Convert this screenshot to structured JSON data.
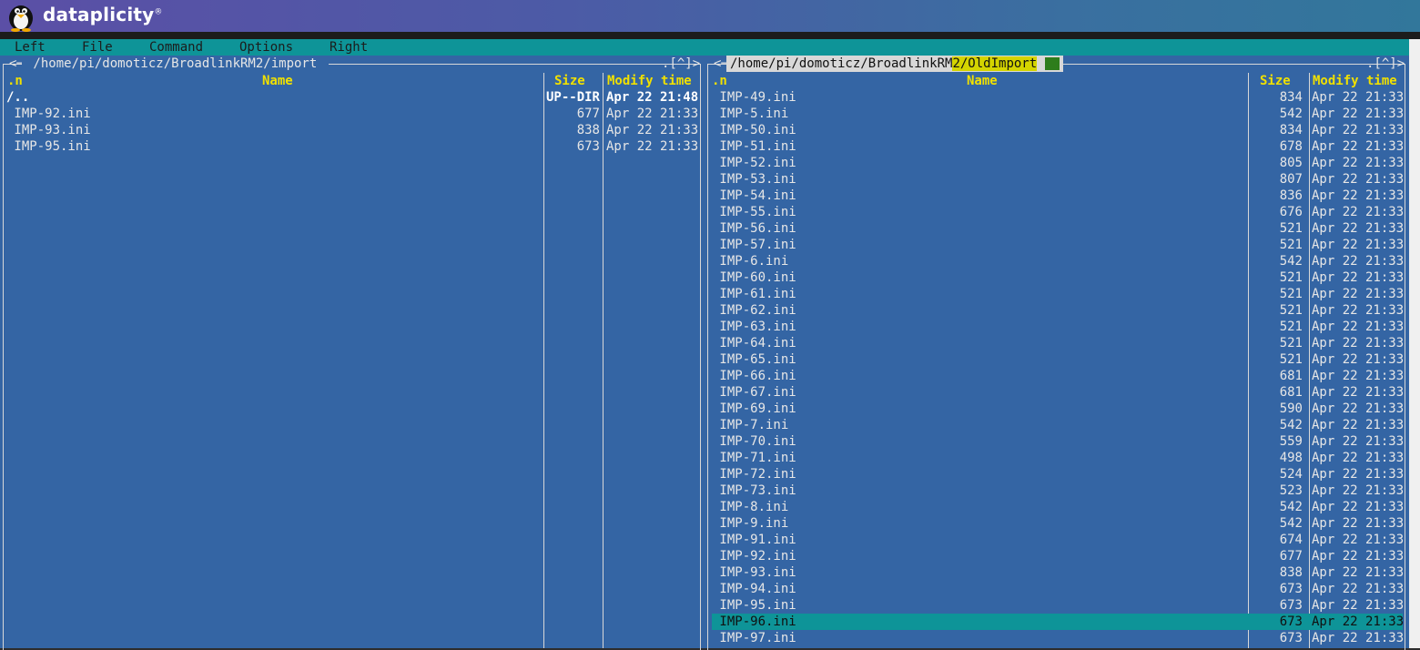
{
  "brand": {
    "name": "dataplicity",
    "reg": "®"
  },
  "menu": [
    "Left",
    "File",
    "Command",
    "Options",
    "Right"
  ],
  "left_panel": {
    "nav": "<─",
    "path": " /home/pi/domoticz/BroadlinkRM2/import ",
    "corner": ".[^]>",
    "headers": {
      "sort": ".n",
      "name": "Name",
      "size": "Size",
      "time": "Modify time"
    },
    "rows": [
      {
        "name": "/..",
        "size": "UP--DIR",
        "time": "Apr 22 21:48",
        "updir": true
      },
      {
        "name": " IMP-92.ini",
        "size": "677",
        "time": "Apr 22 21:33"
      },
      {
        "name": " IMP-93.ini",
        "size": "838",
        "time": "Apr 22 21:33"
      },
      {
        "name": " IMP-95.ini",
        "size": "673",
        "time": "Apr 22 21:33"
      }
    ]
  },
  "right_panel": {
    "nav": "<─",
    "path_a": "/home/pi/domoticz/BroadlinkRM",
    "path_b": "2/OldImport",
    "corner": ".[^]>",
    "headers": {
      "sort": ".n",
      "name": "Name",
      "size": "Size",
      "time": "Modify time"
    },
    "selected_index": 32,
    "rows": [
      {
        "name": " IMP-49.ini",
        "size": "834",
        "time": "Apr 22 21:33"
      },
      {
        "name": " IMP-5.ini",
        "size": "542",
        "time": "Apr 22 21:33"
      },
      {
        "name": " IMP-50.ini",
        "size": "834",
        "time": "Apr 22 21:33"
      },
      {
        "name": " IMP-51.ini",
        "size": "678",
        "time": "Apr 22 21:33"
      },
      {
        "name": " IMP-52.ini",
        "size": "805",
        "time": "Apr 22 21:33"
      },
      {
        "name": " IMP-53.ini",
        "size": "807",
        "time": "Apr 22 21:33"
      },
      {
        "name": " IMP-54.ini",
        "size": "836",
        "time": "Apr 22 21:33"
      },
      {
        "name": " IMP-55.ini",
        "size": "676",
        "time": "Apr 22 21:33"
      },
      {
        "name": " IMP-56.ini",
        "size": "521",
        "time": "Apr 22 21:33"
      },
      {
        "name": " IMP-57.ini",
        "size": "521",
        "time": "Apr 22 21:33"
      },
      {
        "name": " IMP-6.ini",
        "size": "542",
        "time": "Apr 22 21:33"
      },
      {
        "name": " IMP-60.ini",
        "size": "521",
        "time": "Apr 22 21:33"
      },
      {
        "name": " IMP-61.ini",
        "size": "521",
        "time": "Apr 22 21:33"
      },
      {
        "name": " IMP-62.ini",
        "size": "521",
        "time": "Apr 22 21:33"
      },
      {
        "name": " IMP-63.ini",
        "size": "521",
        "time": "Apr 22 21:33"
      },
      {
        "name": " IMP-64.ini",
        "size": "521",
        "time": "Apr 22 21:33"
      },
      {
        "name": " IMP-65.ini",
        "size": "521",
        "time": "Apr 22 21:33"
      },
      {
        "name": " IMP-66.ini",
        "size": "681",
        "time": "Apr 22 21:33"
      },
      {
        "name": " IMP-67.ini",
        "size": "681",
        "time": "Apr 22 21:33"
      },
      {
        "name": " IMP-69.ini",
        "size": "590",
        "time": "Apr 22 21:33"
      },
      {
        "name": " IMP-7.ini",
        "size": "542",
        "time": "Apr 22 21:33"
      },
      {
        "name": " IMP-70.ini",
        "size": "559",
        "time": "Apr 22 21:33"
      },
      {
        "name": " IMP-71.ini",
        "size": "498",
        "time": "Apr 22 21:33"
      },
      {
        "name": " IMP-72.ini",
        "size": "524",
        "time": "Apr 22 21:33"
      },
      {
        "name": " IMP-73.ini",
        "size": "523",
        "time": "Apr 22 21:33"
      },
      {
        "name": " IMP-8.ini",
        "size": "542",
        "time": "Apr 22 21:33"
      },
      {
        "name": " IMP-9.ini",
        "size": "542",
        "time": "Apr 22 21:33"
      },
      {
        "name": " IMP-91.ini",
        "size": "674",
        "time": "Apr 22 21:33"
      },
      {
        "name": " IMP-92.ini",
        "size": "677",
        "time": "Apr 22 21:33"
      },
      {
        "name": " IMP-93.ini",
        "size": "838",
        "time": "Apr 22 21:33"
      },
      {
        "name": " IMP-94.ini",
        "size": "673",
        "time": "Apr 22 21:33"
      },
      {
        "name": " IMP-95.ini",
        "size": "673",
        "time": "Apr 22 21:33"
      },
      {
        "name": " IMP-96.ini",
        "size": "673",
        "time": "Apr 22 21:33"
      },
      {
        "name": " IMP-97.ini",
        "size": "673",
        "time": "Apr 22 21:33"
      }
    ]
  },
  "colors": {
    "panel_bg": "#3465a4",
    "menubar_bg": "#0e9498",
    "header_fg": "#f0e000",
    "selection_bg": "#0e9498"
  }
}
